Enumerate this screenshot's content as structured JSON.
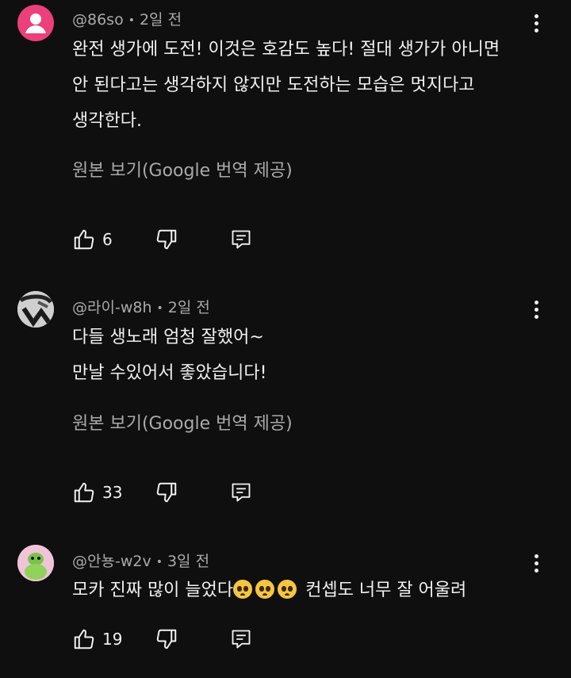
{
  "comments": [
    {
      "handle": "@86so",
      "time": "2일 전",
      "lines": [
        "완전 생가에 도전! 이것은 호감도 높다! 절대 생가가 아니면",
        "안 된다고는 생각하지 않지만 도전하는 모습은 멋지다고",
        "생각한다."
      ],
      "translate": "원본 보기(Google 번역 제공)",
      "likes": "6",
      "avatar_color": "#ec407a"
    },
    {
      "handle": "@라이-w8h",
      "time": "2일 전",
      "lines": [
        "다들 생노래 엄청 잘했어~",
        "만날 수있어서 좋았습니다!"
      ],
      "translate": "원본 보기(Google 번역 제공)",
      "likes": "33"
    },
    {
      "handle": "@안뇽-w2v",
      "time": "3일 전",
      "text_before": "모카 진짜 많이 늘었다",
      "emoji": [
        "pleading-face",
        "pleading-face",
        "pleading-face"
      ],
      "text_after": " 컨셉도 너무 잘 어울려",
      "likes": "19"
    }
  ],
  "icons": {
    "like": "thumbs-up-icon",
    "dislike": "thumbs-down-icon",
    "reply": "reply-icon",
    "more": "more-vert-icon"
  }
}
